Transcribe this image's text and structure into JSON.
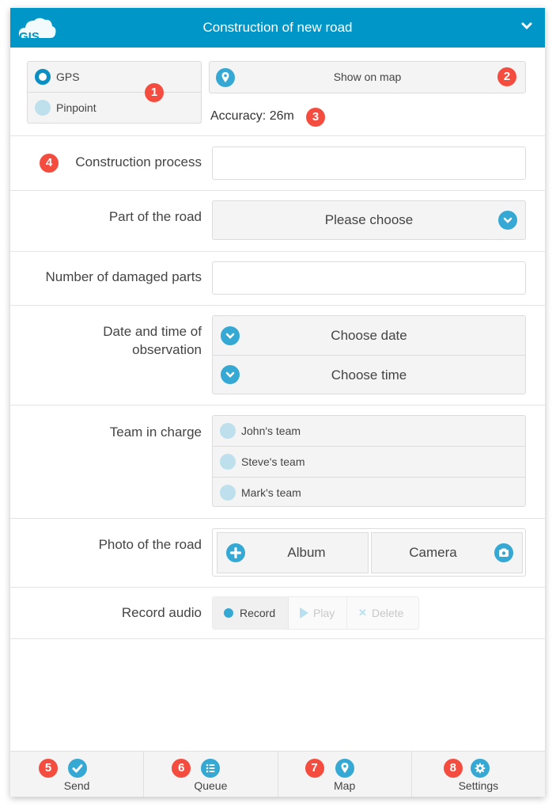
{
  "header": {
    "logo_text": "GIS",
    "title": "Construction of new road",
    "collapse_icon": "chevron-down-icon"
  },
  "location": {
    "options": [
      {
        "label": "GPS",
        "selected": true
      },
      {
        "label": "Pinpoint",
        "selected": false
      }
    ],
    "show_on_map_label": "Show on map",
    "accuracy_text": "Accuracy: 26m",
    "badges": {
      "mode": "1",
      "map": "2",
      "accuracy": "3"
    }
  },
  "fields": {
    "construction_process": {
      "label": "Construction process",
      "value": "",
      "badge": "4"
    },
    "part_of_road": {
      "label": "Part of the road",
      "selected": "Please choose"
    },
    "damaged_parts": {
      "label": "Number of damaged parts",
      "value": ""
    },
    "date_time": {
      "label_line1": "Date and time of",
      "label_line2": "observation",
      "date_label": "Choose date",
      "time_label": "Choose time"
    },
    "team": {
      "label": "Team in charge",
      "options": [
        "John's team",
        "Steve's team",
        "Mark's team"
      ]
    },
    "photo": {
      "label": "Photo of the road",
      "album_label": "Album",
      "camera_label": "Camera"
    },
    "audio": {
      "label": "Record audio",
      "record_label": "Record",
      "play_label": "Play",
      "delete_label": "Delete"
    }
  },
  "footer": {
    "tabs": [
      {
        "label": "Send",
        "icon": "check-icon",
        "badge": "5"
      },
      {
        "label": "Queue",
        "icon": "list-icon",
        "badge": "6"
      },
      {
        "label": "Map",
        "icon": "map-pin-icon",
        "badge": "7"
      },
      {
        "label": "Settings",
        "icon": "gear-icon",
        "badge": "8"
      }
    ]
  },
  "colors": {
    "header": "#0096c7",
    "accent": "#35a8d4",
    "badge": "#f44d3f"
  }
}
